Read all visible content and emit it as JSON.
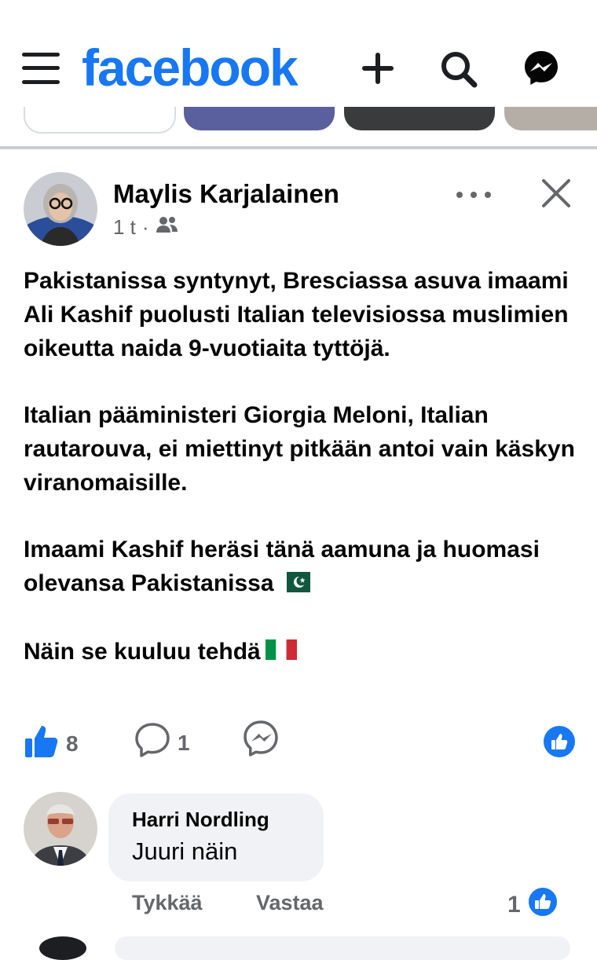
{
  "app": {
    "logo": "facebook",
    "brand_color": "#1877f2"
  },
  "header": {
    "menu_icon": "hamburger-menu-icon",
    "create_icon": "plus-icon",
    "search_icon": "search-icon",
    "messenger_icon": "messenger-icon"
  },
  "post": {
    "author": "Maylis Karjalainen",
    "time": "1 t",
    "separator": "·",
    "audience_icon": "friends-icon",
    "paragraphs": [
      "Pakistanissa syntynyt, Bresciassa asuva imaami Ali Kashif puolusti Italian televisiossa muslimien oikeutta naida 9-vuotiaita tyttöjä.",
      "Italian pääministeri Giorgia Meloni, Italian rautarouva, ei miettinyt pitkään antoi vain käskyn viranomaisille.",
      "Imaami Kashif heräsi tänä aamuna ja huomasi olevansa Pakistanissa",
      "Näin se kuuluu tehdä"
    ],
    "reactions": {
      "like_count": "8",
      "comment_count": "1"
    }
  },
  "comment": {
    "author": "Harri Nordling",
    "text": "Juuri näin",
    "like_label": "Tykkää",
    "reply_label": "Vastaa",
    "like_count": "1"
  }
}
